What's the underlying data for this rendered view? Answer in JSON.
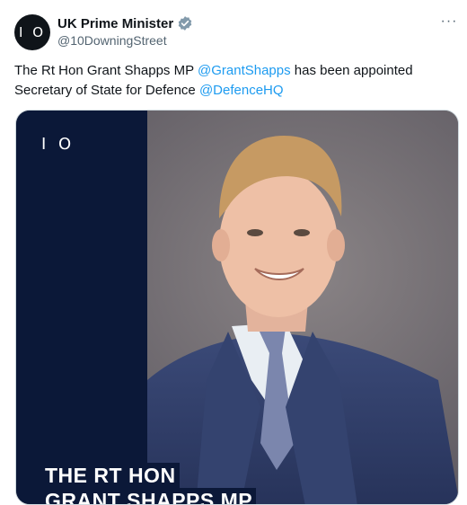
{
  "tweet": {
    "avatar_text": "I O",
    "display_name": "UK Prime Minister",
    "handle": "@10DowningStreet",
    "more_label": "···",
    "text_line1_before": "The Rt Hon Grant Shapps MP ",
    "mention1": "@GrantShapps",
    "text_line1_after": " has been appointed",
    "text_line2_before": "Secretary of State for Defence ",
    "mention2": "@DefenceHQ"
  },
  "media": {
    "logo_text": "I O",
    "caption_line1": "THE RT HON",
    "caption_line2": "GRANT SHAPPS MP"
  },
  "colors": {
    "mention": "#1d9bf0",
    "verified": "#829aab",
    "navy_panel": "#0b1838"
  },
  "icons": {
    "verified": "verified-badge-icon",
    "more": "more-options-icon"
  }
}
